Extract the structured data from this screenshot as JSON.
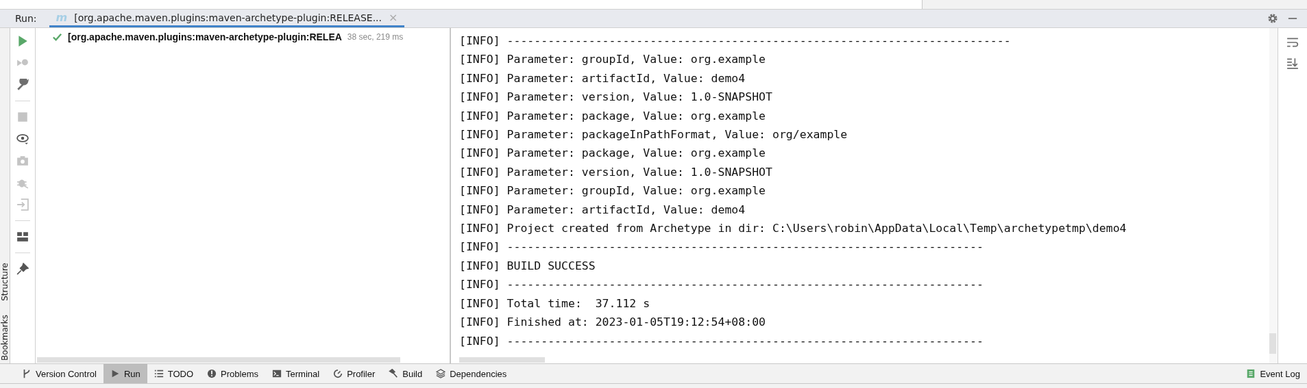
{
  "run_header": {
    "label": "Run:",
    "tabs": [
      {
        "badge": "m",
        "label": "[org.apache.maven.plugins:maven-archetype-plugin:RELEASE...",
        "close": "×",
        "selected": true
      }
    ]
  },
  "side_labels": [
    "Structure",
    "Bookmarks"
  ],
  "tree": {
    "items": [
      {
        "label": "[org.apache.maven.plugins:maven-archetype-plugin:RELEA",
        "time": "38 sec, 219 ms",
        "passed": true
      }
    ]
  },
  "console": {
    "lines": [
      "[INFO] --------------------------------------------------------------------------",
      "[INFO] Parameter: groupId, Value: org.example",
      "[INFO] Parameter: artifactId, Value: demo4",
      "[INFO] Parameter: version, Value: 1.0-SNAPSHOT",
      "[INFO] Parameter: package, Value: org.example",
      "[INFO] Parameter: packageInPathFormat, Value: org/example",
      "[INFO] Parameter: package, Value: org.example",
      "[INFO] Parameter: version, Value: 1.0-SNAPSHOT",
      "[INFO] Parameter: groupId, Value: org.example",
      "[INFO] Parameter: artifactId, Value: demo4",
      "[INFO] Project created from Archetype in dir: C:\\Users\\robin\\AppData\\Local\\Temp\\archetypetmp\\demo4",
      "[INFO] ----------------------------------------------------------------------",
      "[INFO] BUILD SUCCESS",
      "[INFO] ----------------------------------------------------------------------",
      "[INFO] Total time:  37.112 s",
      "[INFO] Finished at: 2023-01-05T19:12:54+08:00",
      "[INFO] ----------------------------------------------------------------------"
    ]
  },
  "bottom_bar": {
    "tabs": [
      {
        "label": "Version Control",
        "selected": false
      },
      {
        "label": "Run",
        "selected": true
      },
      {
        "label": "TODO",
        "selected": false
      },
      {
        "label": "Problems",
        "selected": false
      },
      {
        "label": "Terminal",
        "selected": false
      },
      {
        "label": "Profiler",
        "selected": false
      },
      {
        "label": "Build",
        "selected": false
      },
      {
        "label": "Dependencies",
        "selected": false
      }
    ],
    "right_tabs": [
      {
        "label": "Event Log",
        "selected": false
      }
    ]
  }
}
